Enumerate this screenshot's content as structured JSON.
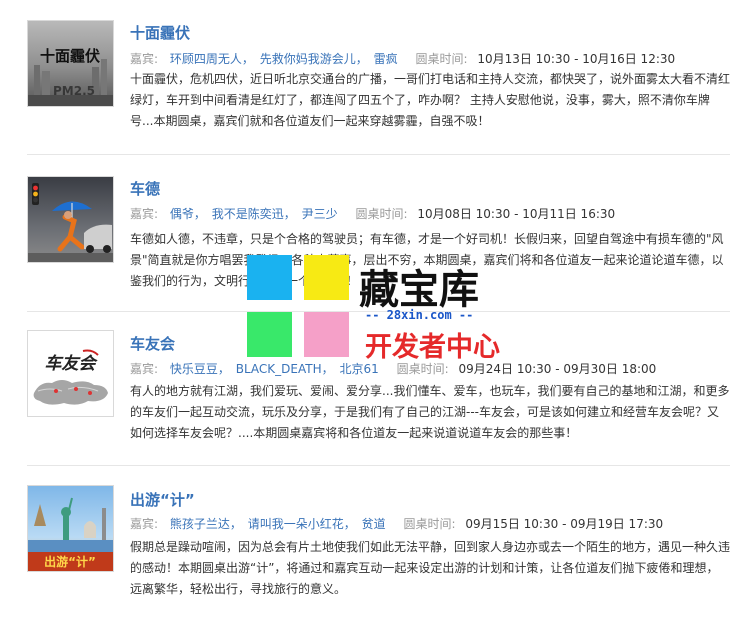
{
  "meta_labels": {
    "guest_label": "嘉宾:",
    "time_label": "圆桌时间:"
  },
  "items": [
    {
      "title": "十面霾伏",
      "thumb_text": "十面霾伏",
      "thumb_sub": "PM2.5",
      "guests": [
        "环顾四周无人",
        "先救你妈我游会儿",
        "雷疯"
      ],
      "time": "10月13日 10:30 - 10月16日 12:30",
      "description": "十面霾伏，危机四伏，近日听北京交通台的广播，一哥们打电话和主持人交流，都快哭了，说外面雾太大看不清红绿灯，车开到中间看清是红灯了，都连闯了四五个了，咋办啊？ 主持人安慰他说，没事，雾大，照不清你车牌号...本期圆桌，嘉宾们就和各位道友们一起来穿越雾霾，自强不吸！"
    },
    {
      "title": "车德",
      "guests": [
        "偶爷",
        "我不是陈奕迅",
        "尹三少"
      ],
      "time": "10月08日 10:30 - 10月11日 16:30",
      "description": "车德如人德，不违章，只是个合格的驾驶员；有车德，才是一个好司机！长假归来，回望自驾途中有损车德的\"风景\"简直就是你方唱罢我登场，各种奇葩事，层出不穷，本期圆桌，嘉宾们将和各位道友一起来论道论道车德，以鉴我们的行为，文明行车，做一个好司机！"
    },
    {
      "title": "车友会",
      "thumb_text": "车友会",
      "guests": [
        "快乐豆豆",
        "BLACK_DEATH",
        "北京61"
      ],
      "time": "09月24日 10:30 - 09月30日 18:00",
      "description": "有人的地方就有江湖，我们爱玩、爱闹、爱分享...我们懂车、爱车，也玩车，我们要有自己的基地和江湖，和更多的车友们一起互动交流，玩乐及分享，于是我们有了自己的江湖---车友会，可是该如何建立和经营车友会呢？又如何选择车友会呢？....本期圆桌嘉宾将和各位道友一起来说道说道车友会的那些事！"
    },
    {
      "title": "出游“计”",
      "thumb_text": "出游“计”",
      "guests": [
        "熊孩子兰达",
        "请叫我一朵小红花",
        "贫道"
      ],
      "time": "09月15日 10:30 - 09月19日 17:30",
      "description": "假期总是躁动喧闹，因为总会有片土地使我们如此无法平静，回到家人身边亦或去一个陌生的地方，遇见一种久违的感动！本期圆桌出游“计”，将通过和嘉宾互动一起来设定出游的计划和计策，让各位道友们抛下疲倦和理想，远离繁华，轻松出行，寻找旅行的意义。"
    }
  ],
  "watermark": {
    "brand": "藏宝库",
    "site": "-- 28xin.com --",
    "sub": "开发者中心",
    "colors": [
      "#1ab2f0",
      "#f7ea14",
      "#39e86a",
      "#f5a0c8"
    ]
  }
}
